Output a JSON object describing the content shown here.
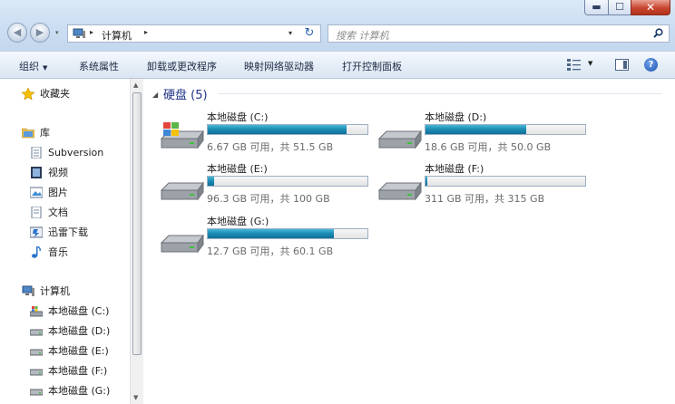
{
  "window": {
    "minimize_glyph": "▬",
    "maximize_glyph": "☐",
    "close_glyph": "✕"
  },
  "nav": {
    "back_glyph": "◀",
    "forward_glyph": "▶",
    "recent_glyph": "▾",
    "breadcrumb": [
      "计算机"
    ],
    "breadcrumb_sep": "▸",
    "refresh_glyph": "↻",
    "search_placeholder": "搜索 计算机"
  },
  "commandbar": {
    "organize": "组织",
    "organize_arrow": "▼",
    "system_properties": "系统属性",
    "uninstall": "卸载或更改程序",
    "map_drive": "映射网络驱动器",
    "control_panel": "打开控制面板",
    "view_arrow": "▼",
    "help": "?"
  },
  "sidebar": {
    "favorites": "收藏夹",
    "libraries": "库",
    "library_items": [
      "Subversion",
      "视频",
      "图片",
      "文档",
      "迅雷下载",
      "音乐"
    ],
    "computer": "计算机",
    "drives": [
      "本地磁盘 (C:)",
      "本地磁盘 (D:)",
      "本地磁盘 (E:)",
      "本地磁盘 (F:)",
      "本地磁盘 (G:)"
    ],
    "scroll_up": "▲",
    "scroll_down": "▼"
  },
  "content": {
    "group_arrow": "◢",
    "group_title": "硬盘 (5)",
    "drives": [
      {
        "name": "本地磁盘 (C:)",
        "free": "6.67 GB 可用，共 51.5 GB",
        "used_fraction": 0.87,
        "icon": "windows-drive-icon"
      },
      {
        "name": "本地磁盘 (D:)",
        "free": "18.6 GB 可用，共 50.0 GB",
        "used_fraction": 0.63,
        "icon": "hard-drive-icon"
      },
      {
        "name": "本地磁盘 (E:)",
        "free": "96.3 GB 可用，共 100 GB",
        "used_fraction": 0.037,
        "icon": "hard-drive-icon"
      },
      {
        "name": "本地磁盘 (F:)",
        "free": "311 GB 可用，共 315 GB",
        "used_fraction": 0.013,
        "icon": "hard-drive-icon"
      },
      {
        "name": "本地磁盘 (G:)",
        "free": "12.7 GB 可用，共 60.1 GB",
        "used_fraction": 0.79,
        "icon": "hard-drive-icon"
      }
    ]
  },
  "colors": {
    "bar_fill": "#1e8db4",
    "title_blue": "#1e3287"
  }
}
